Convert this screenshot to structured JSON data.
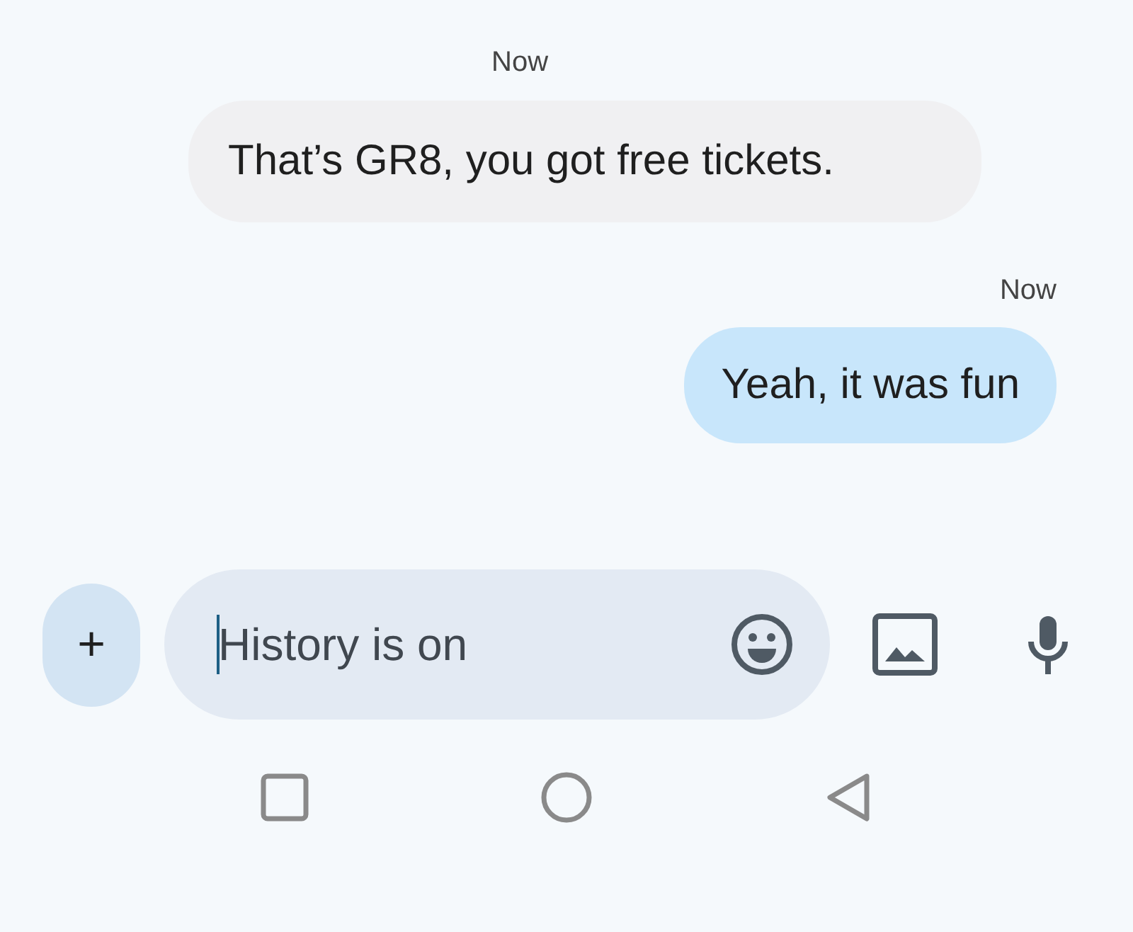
{
  "messages": [
    {
      "kind": "incoming",
      "time": "Now",
      "text": "That’s GR8, you got free tickets."
    },
    {
      "kind": "outgoing",
      "time": "Now",
      "text": "Yeah, it was fun"
    }
  ],
  "composer": {
    "add_label": "+",
    "placeholder": "History is on"
  }
}
